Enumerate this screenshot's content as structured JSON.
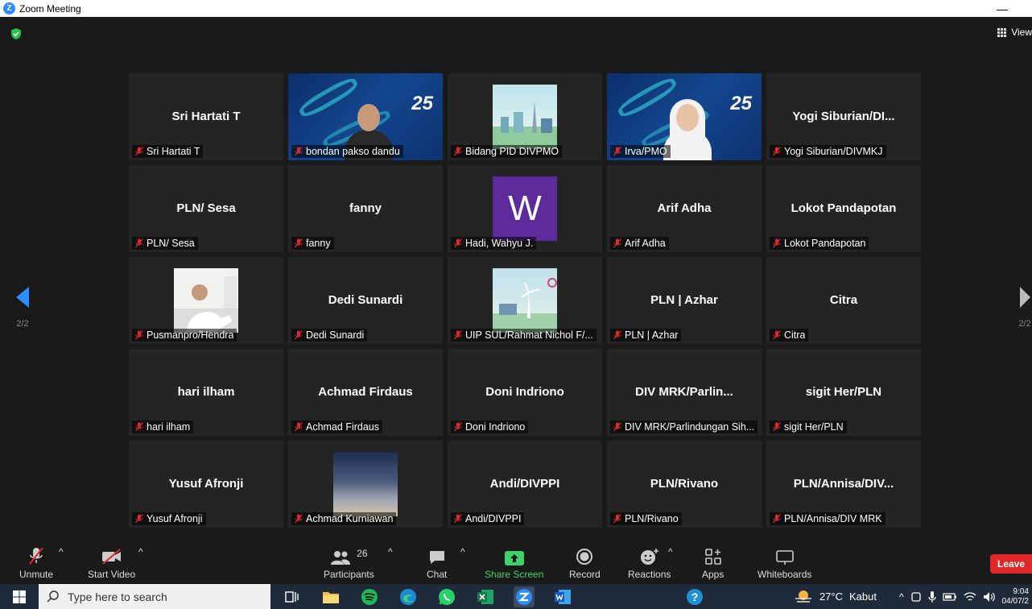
{
  "window": {
    "title": "Zoom Meeting",
    "minimize_label": "—"
  },
  "view": {
    "label": "View"
  },
  "pagination": {
    "left_page": "2/2",
    "right_page": "2/2"
  },
  "tiles": [
    {
      "center": "Sri Hartati T",
      "label": "Sri Hartati T",
      "type": "name"
    },
    {
      "center": "",
      "label": "bondan pakso dandu",
      "type": "video-man",
      "active": true
    },
    {
      "center": "",
      "label": "Bidang PID DIVPMO",
      "type": "image-city"
    },
    {
      "center": "",
      "label": "Irva/PMO",
      "type": "video-woman"
    },
    {
      "center": "Yogi  Siburian/DI...",
      "label": "Yogi Siburian/DIVMKJ",
      "type": "name"
    },
    {
      "center": "PLN/ Sesa",
      "label": "PLN/ Sesa",
      "type": "name"
    },
    {
      "center": "fanny",
      "label": "fanny",
      "type": "name"
    },
    {
      "center": "W",
      "label": "Hadi, Wahyu J.",
      "type": "avatar-w"
    },
    {
      "center": "Arif Adha",
      "label": "Arif Adha",
      "type": "name"
    },
    {
      "center": "Lokot Pandapotan",
      "label": "Lokot Pandapotan",
      "type": "name"
    },
    {
      "center": "",
      "label": "Pusmanpro/Hendra",
      "type": "image-man"
    },
    {
      "center": "Dedi Sunardi",
      "label": "Dedi Sunardi",
      "type": "name"
    },
    {
      "center": "",
      "label": "UIP SUL/Rahmat Nichol F/...",
      "type": "image-g20"
    },
    {
      "center": "PLN | Azhar",
      "label": "PLN | Azhar",
      "type": "name"
    },
    {
      "center": "Citra",
      "label": "Citra",
      "type": "name"
    },
    {
      "center": "hari ilham",
      "label": "hari ilham",
      "type": "name"
    },
    {
      "center": "Achmad Firdaus",
      "label": "Achmad Firdaus",
      "type": "name"
    },
    {
      "center": "Doni Indriono",
      "label": "Doni Indriono",
      "type": "name"
    },
    {
      "center": "DIV  MRK/Parlin...",
      "label": "DIV MRK/Parlindungan Sih...",
      "type": "name"
    },
    {
      "center": "sigit Her/PLN",
      "label": "sigit Her/PLN",
      "type": "name"
    },
    {
      "center": "Yusuf Afronji",
      "label": "Yusuf Afronji",
      "type": "name"
    },
    {
      "center": "",
      "label": "Achmad Kurniawan",
      "type": "image-sky"
    },
    {
      "center": "Andi/DIVPPI",
      "label": "Andi/DIVPPI",
      "type": "name"
    },
    {
      "center": "PLN/Rivano",
      "label": "PLN/Rivano",
      "type": "name"
    },
    {
      "center": "PLN/Annisa/DIV...",
      "label": "PLN/Annisa/DIV MRK",
      "type": "name"
    }
  ],
  "controls": {
    "unmute": "Unmute",
    "start_video": "Start Video",
    "participants": "Participants",
    "participants_count": "26",
    "chat": "Chat",
    "share_screen": "Share Screen",
    "record": "Record",
    "reactions": "Reactions",
    "apps": "Apps",
    "whiteboards": "Whiteboards",
    "leave": "Leave"
  },
  "taskbar": {
    "search_placeholder": "Type here to search",
    "temperature": "27°C",
    "weather": "Kabut",
    "time": "9:04",
    "date": "04/07/2"
  },
  "colors": {
    "accent_green": "#3fd16a",
    "leave_red": "#e02828",
    "active_speaker": "#e6e67a",
    "zoom_blue": "#2d8cff"
  }
}
